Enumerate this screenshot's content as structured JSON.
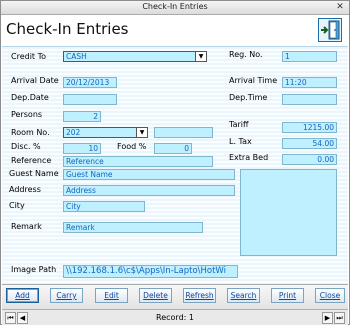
{
  "window": {
    "title": "Check-In Entries",
    "close": "✕"
  },
  "header": {
    "title": "Check-In Entries"
  },
  "form": {
    "credit_to": {
      "label": "Credit To",
      "value": "CASH"
    },
    "reg_no": {
      "label": "Reg. No.",
      "value": "1"
    },
    "arrival_date": {
      "label": "Arrival Date",
      "value": "20/12/2013"
    },
    "arrival_time": {
      "label": "Arrival Time",
      "value": "11:20"
    },
    "dep_date": {
      "label": "Dep.Date",
      "value": ""
    },
    "dep_time": {
      "label": "Dep.Time",
      "value": ""
    },
    "persons": {
      "label": "Persons",
      "value": "2"
    },
    "room_no": {
      "label": "Room No.",
      "value": "202",
      "extra": ""
    },
    "tariff": {
      "label": "Tariff",
      "value": "1215.00"
    },
    "disc": {
      "label": "Disc. %",
      "value": "10"
    },
    "food": {
      "label": "Food %",
      "value": "0"
    },
    "l_tax": {
      "label": "L. Tax",
      "value": "54.00"
    },
    "reference": {
      "label": "Reference",
      "value": "Reference"
    },
    "extra_bed": {
      "label": "Extra Bed",
      "value": "0.00"
    },
    "guest_name": {
      "label": "Guest Name",
      "value": "Guest Name"
    },
    "address": {
      "label": "Address",
      "value": "Address"
    },
    "city": {
      "label": "City",
      "value": "City"
    },
    "remark": {
      "label": "Remark",
      "value": "Remark"
    },
    "image_path": {
      "label": "Image Path",
      "value": "\\\\192.168.1.6\\c$\\Apps\\In-Lapto\\HotWi"
    }
  },
  "buttons": {
    "add": "Add",
    "carry": "Carry",
    "edit": "Edit",
    "delete": "Delete",
    "refresh": "Refresh",
    "search": "Search",
    "print": "Print",
    "close": "Close"
  },
  "nav": {
    "record_label": "Record: 1",
    "first": "⏮",
    "prev": "◀",
    "next": "▶",
    "last": "⏭"
  },
  "colors": {
    "field_bg": "#bff0ff",
    "field_text": "#1565c0",
    "accent": "#1b6fa8"
  }
}
